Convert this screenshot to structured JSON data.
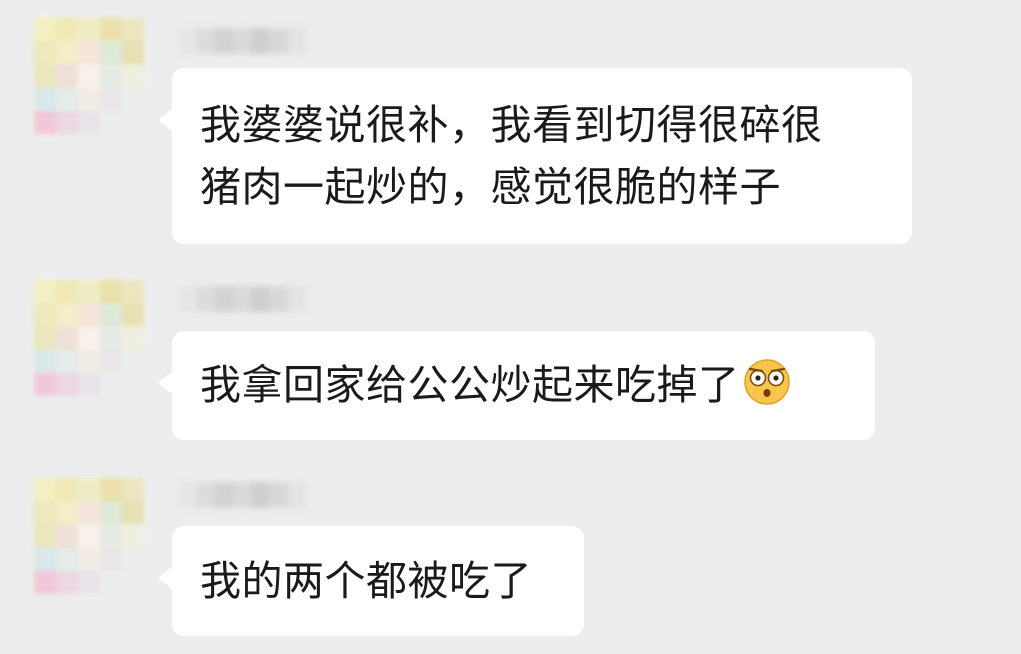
{
  "chat": {
    "messages": [
      {
        "lines": [
          "我婆婆说很补，我看到切得很碎很",
          "猪肉一起炒的，感觉很脆的样子"
        ],
        "emoji": null
      },
      {
        "lines": [
          "我拿回家给公公炒起来吃掉了"
        ],
        "emoji": "shocked-face-emoji"
      },
      {
        "lines": [
          "我的两个都被吃了"
        ],
        "emoji": null
      }
    ]
  },
  "colors": {
    "background": "#ededed",
    "bubble": "#ffffff",
    "text": "#1a1a1a"
  }
}
